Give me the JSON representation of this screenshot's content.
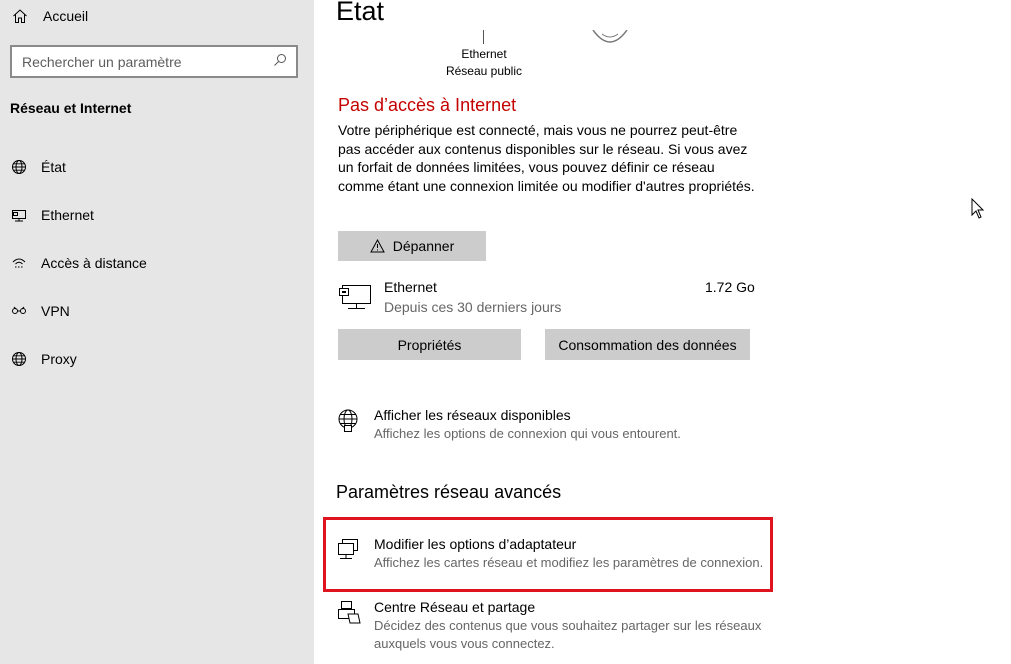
{
  "sidebar": {
    "home_label": "Accueil",
    "search_placeholder": "Rechercher un paramètre",
    "section_title": "Réseau et Internet",
    "items": [
      {
        "label": "État",
        "icon": "globe-icon"
      },
      {
        "label": "Ethernet",
        "icon": "ethernet-icon"
      },
      {
        "label": "Accès à distance",
        "icon": "dialup-icon"
      },
      {
        "label": "VPN",
        "icon": "vpn-icon"
      },
      {
        "label": "Proxy",
        "icon": "globe-icon"
      }
    ]
  },
  "main": {
    "title": "État",
    "network_caption_line1": "Ethernet",
    "network_caption_line2": "Réseau public",
    "alert_title": "Pas d’accès à Internet",
    "alert_text": "Votre périphérique est connecté, mais vous ne pourrez peut-être pas accéder aux contenus disponibles sur le réseau. Si vous avez un forfait de données limitées, vous pouvez définir ce réseau comme étant une connexion limitée ou modifier d'autres propriétés.",
    "troubleshoot_label": "Dépanner",
    "ethernet": {
      "name": "Ethernet",
      "period": "Depuis ces 30 derniers jours",
      "usage": "1.72 Go"
    },
    "properties_label": "Propriétés",
    "data_usage_label": "Consommation des données",
    "show_networks": {
      "title": "Afficher les réseaux disponibles",
      "subtitle": "Affichez les options de connexion qui vous entourent."
    },
    "advanced_title": "Paramètres réseau avancés",
    "adapter_options": {
      "title": "Modifier les options d’adaptateur",
      "subtitle": "Affichez les cartes réseau et modifiez les paramètres de connexion."
    },
    "sharing_center": {
      "title": "Centre Réseau et partage",
      "subtitle_line1": "Décidez des contenus que vous souhaitez partager sur les réseaux",
      "subtitle_line2": "auxquels vous vous connectez."
    }
  },
  "colors": {
    "sidebar_bg": "#e6e6e6",
    "alert": "#c50000",
    "button_bg": "#cccccc",
    "highlight": "#e0141e"
  }
}
